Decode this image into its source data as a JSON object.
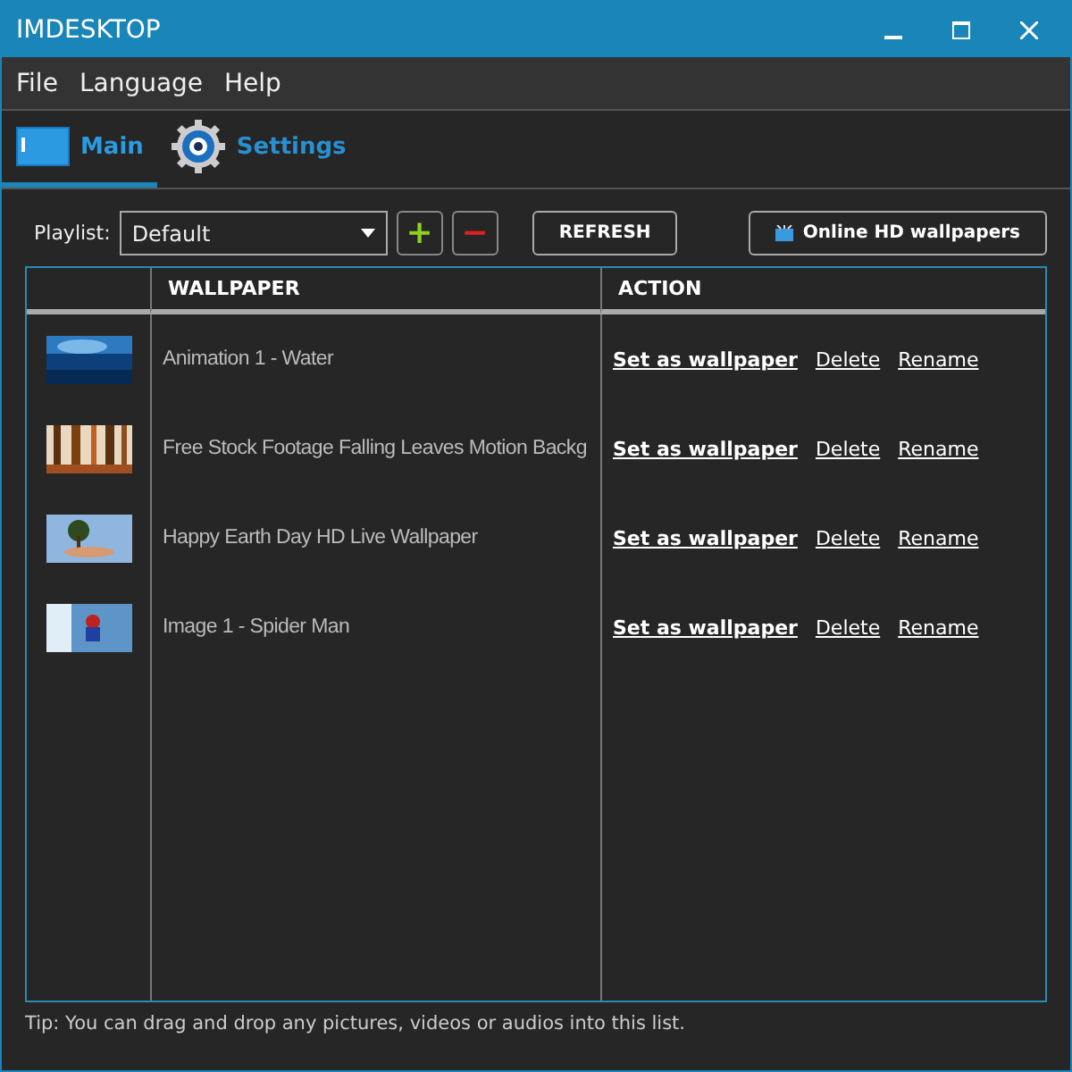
{
  "window": {
    "title": "IMDESKTOP"
  },
  "menu": [
    "File",
    "Language",
    "Help"
  ],
  "tabs": [
    {
      "label": "Main",
      "kind": "monitor",
      "selected": true
    },
    {
      "label": "Settings",
      "kind": "gear",
      "selected": false
    }
  ],
  "playlist": {
    "label": "Playlist:",
    "value": "Default"
  },
  "buttons": {
    "add": "+",
    "remove": "−",
    "refresh": "REFRESH",
    "online": "Online HD wallpapers"
  },
  "table": {
    "columns": [
      "WALLPAPER",
      "ACTION"
    ],
    "rows": [
      {
        "name": "Animation 1 - Water",
        "actions": [
          "Set as wallpaper",
          "Delete",
          "Rename"
        ]
      },
      {
        "name": "Free Stock Footage Falling Leaves Motion Backg",
        "actions": [
          "Set as wallpaper",
          "Delete",
          "Rename"
        ]
      },
      {
        "name": "Happy Earth Day HD Live Wallpaper",
        "actions": [
          "Set as wallpaper",
          "Delete",
          "Rename"
        ]
      },
      {
        "name": "Image 1 - Spider Man",
        "actions": [
          "Set as wallpaper",
          "Delete",
          "Rename"
        ]
      }
    ]
  },
  "tip": "Tip: You can drag and drop any pictures, videos or audios into this list."
}
